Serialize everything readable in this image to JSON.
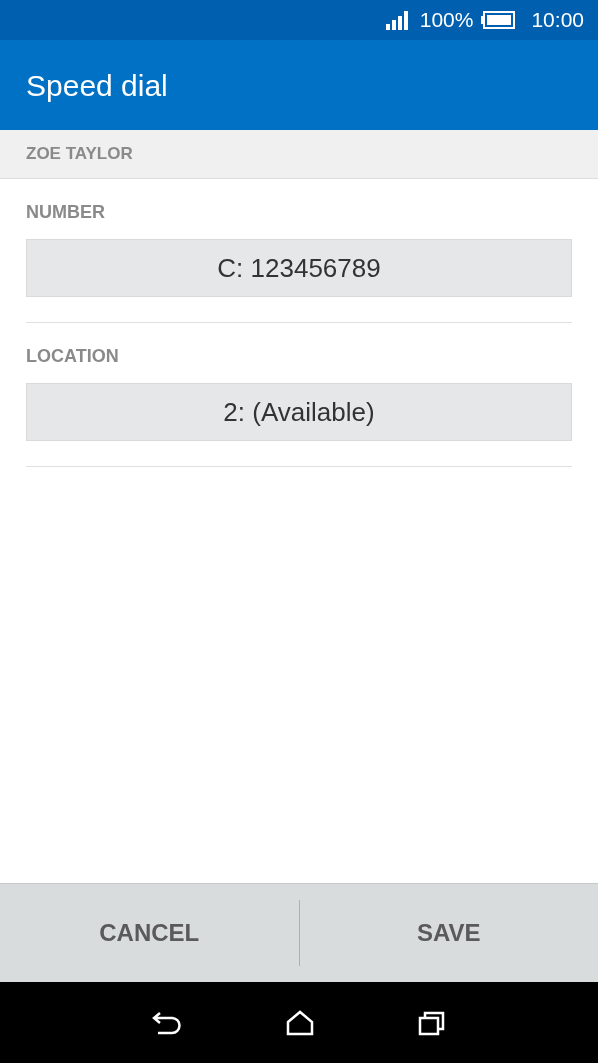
{
  "status_bar": {
    "battery": "100%",
    "time": "10:00"
  },
  "app_bar": {
    "title": "Speed dial"
  },
  "contact": {
    "name": "ZOE TAYLOR"
  },
  "fields": [
    {
      "label": "NUMBER",
      "value": "C: 123456789"
    },
    {
      "label": "LOCATION",
      "value": "2: (Available)"
    }
  ],
  "buttons": [
    "CANCEL",
    "SAVE"
  ]
}
